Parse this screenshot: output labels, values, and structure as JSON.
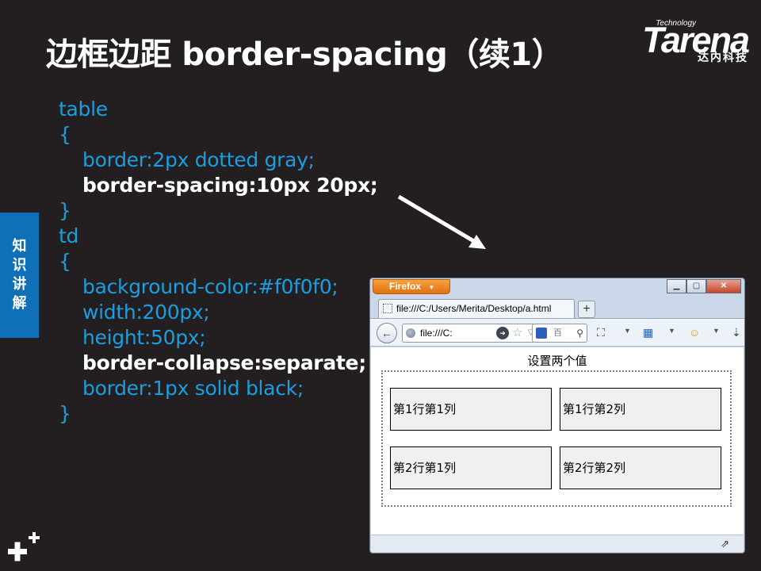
{
  "slide": {
    "title": "边框边距 border-spacing（续1）",
    "logo": {
      "small": "Technology",
      "word": "Tarena",
      "cn": "达内科技"
    },
    "side_tab": [
      "知",
      "识",
      "讲",
      "解"
    ]
  },
  "code": {
    "lines": [
      "table",
      "{",
      "border:2px dotted gray;",
      "border-spacing:10px 20px;",
      "}",
      "td",
      "{",
      "background-color:#f0f0f0;",
      "width:200px;",
      "height:50px;",
      "border-collapse:separate;",
      "border:1px solid black;",
      "}"
    ]
  },
  "browser": {
    "menu_button": "Firefox",
    "tab_title": "file:///C:/Users/Merita/Desktop/a.html",
    "new_tab": "+",
    "url": "file:///C:",
    "search_placeholder": "百",
    "caption": "设置两个值",
    "cells": [
      "第1行第1列",
      "第1行第2列",
      "第2行第1列",
      "第2行第2列"
    ]
  },
  "colors": {
    "background": "#231f20",
    "code_blue": "#1a9ee0",
    "side_tab": "#0f70b7",
    "cell_bg": "#f0f0f0"
  }
}
